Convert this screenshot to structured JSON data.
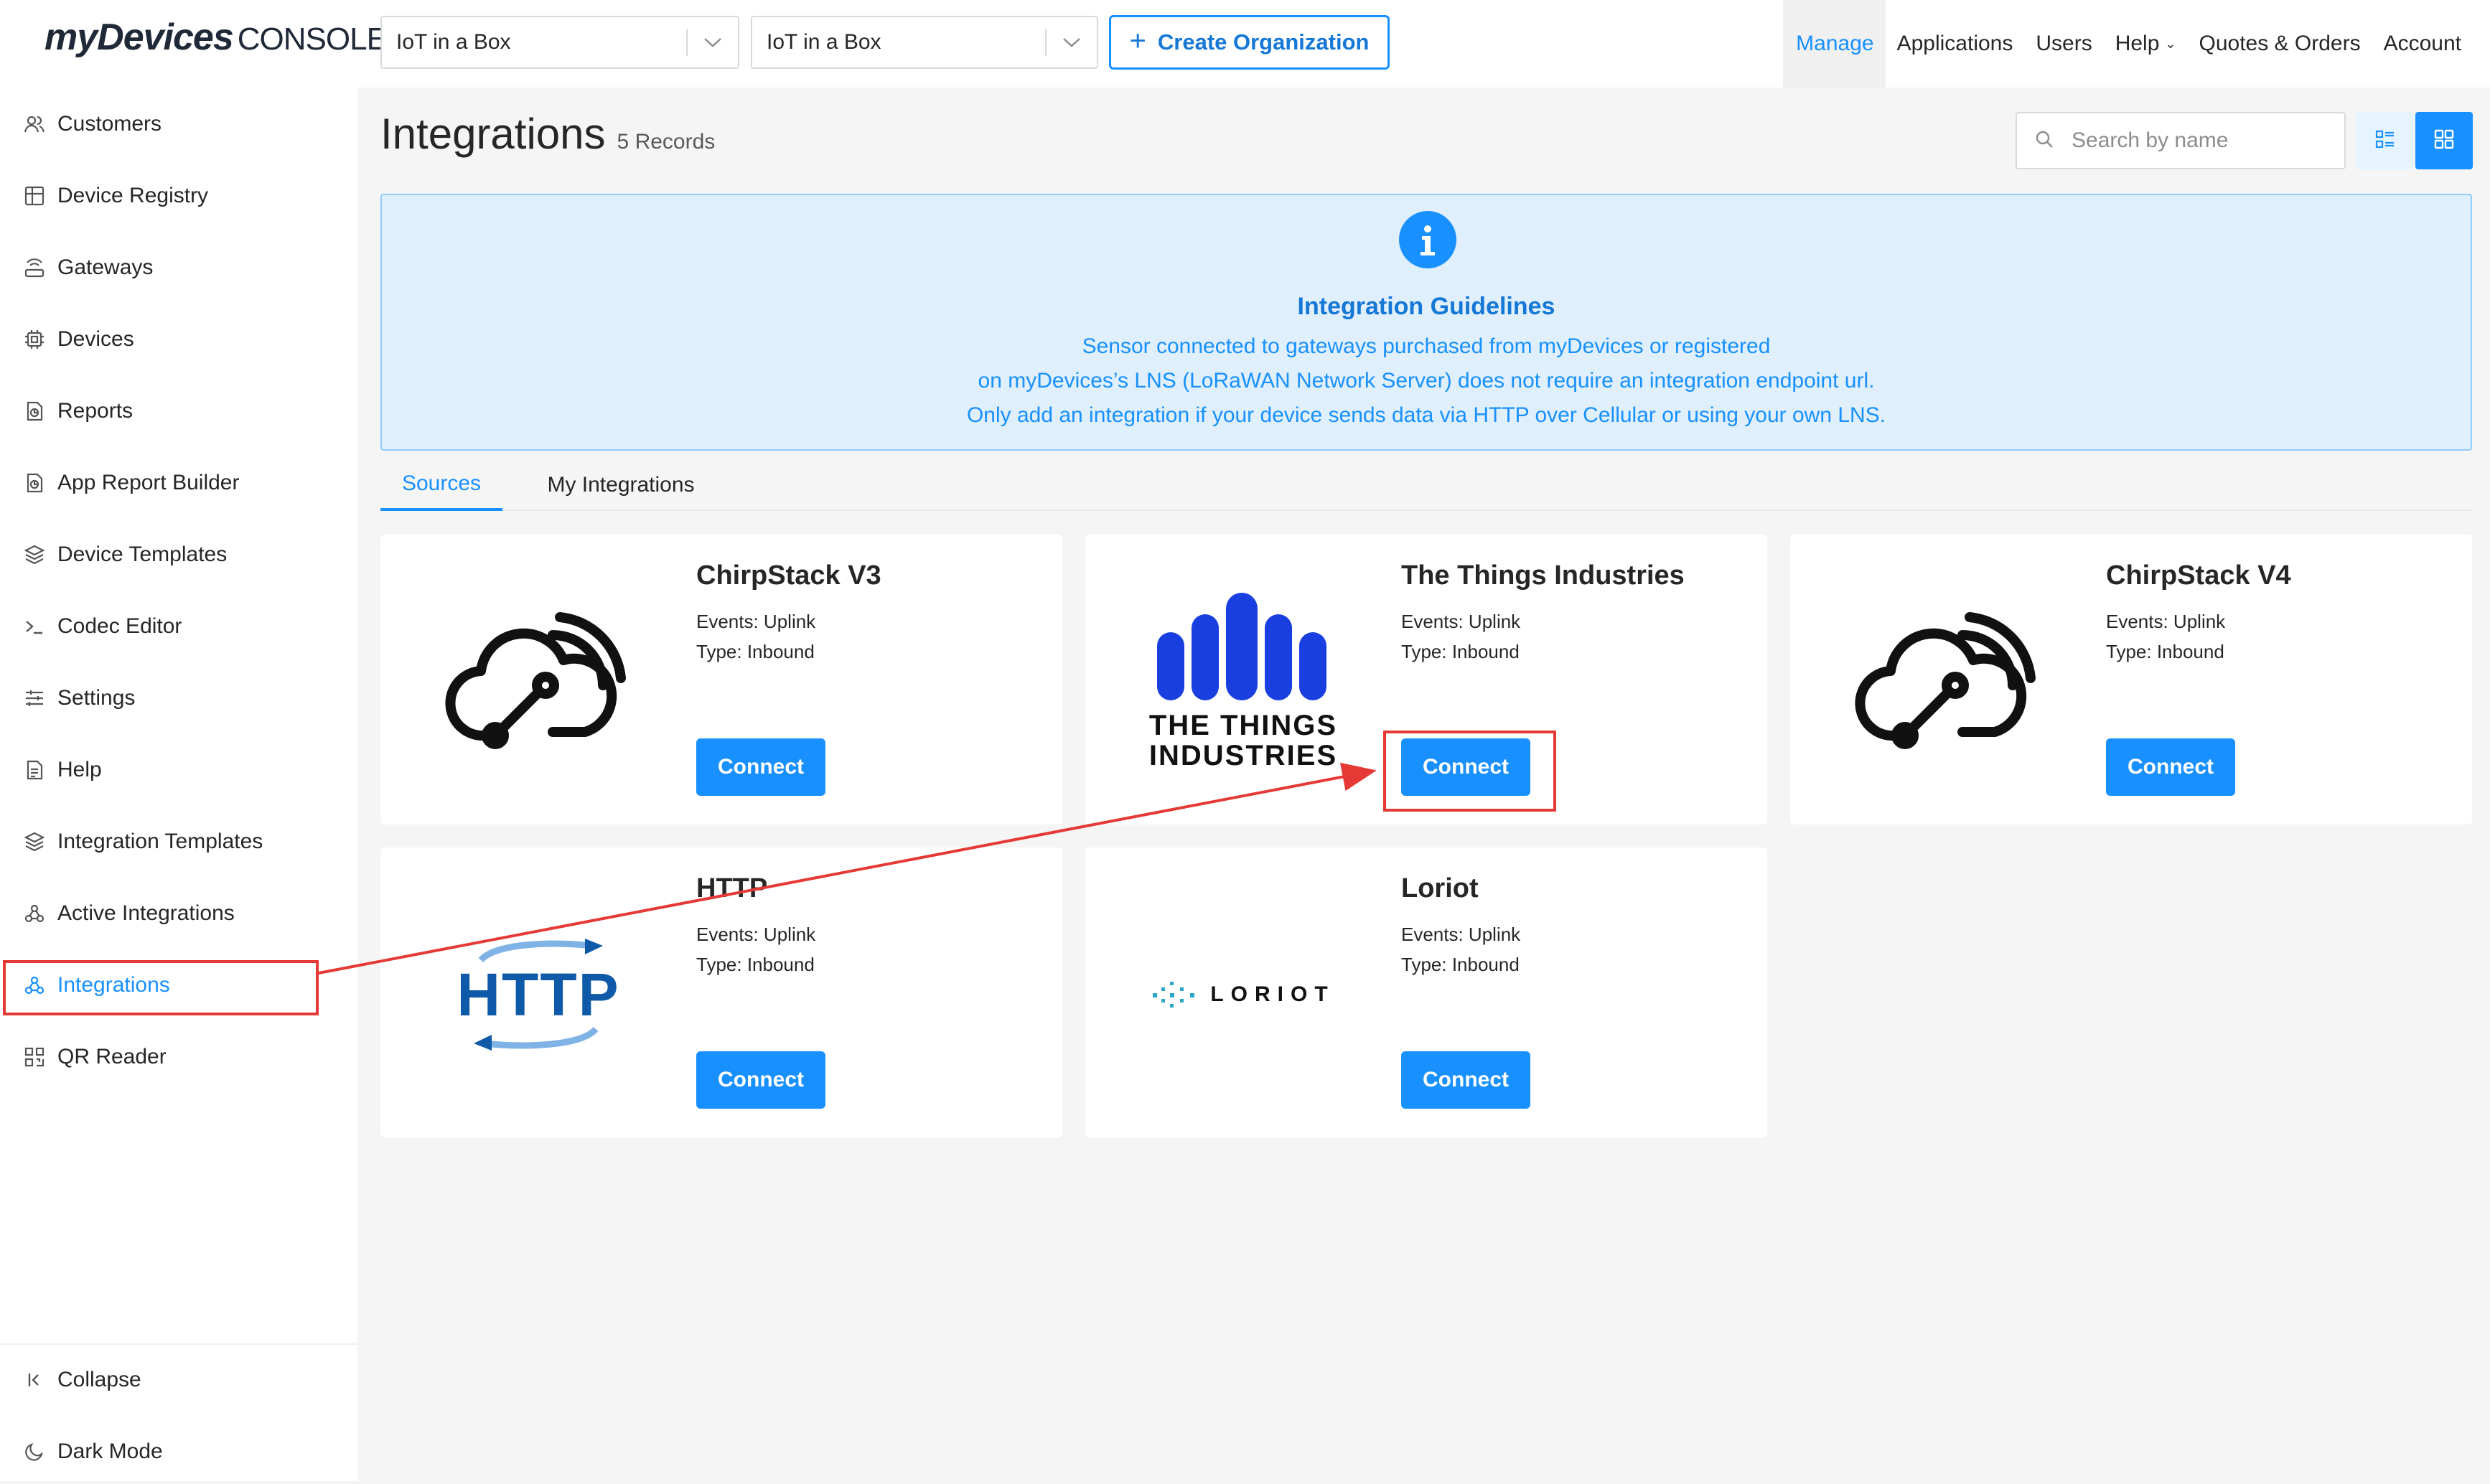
{
  "header": {
    "logo_main": "myDevices",
    "logo_sub": "CONSOLE",
    "org_select_1": "IoT in a Box",
    "org_select_2": "IoT in a Box",
    "create_org_label": "Create Organization",
    "nav": [
      {
        "label": "Manage",
        "active": true
      },
      {
        "label": "Applications"
      },
      {
        "label": "Users"
      },
      {
        "label": "Help"
      },
      {
        "label": "Quotes & Orders"
      },
      {
        "label": "Account"
      }
    ]
  },
  "sidebar": {
    "items": [
      {
        "label": "Customers",
        "icon": "users-icon"
      },
      {
        "label": "Device Registry",
        "icon": "registry-icon"
      },
      {
        "label": "Gateways",
        "icon": "gateway-icon"
      },
      {
        "label": "Devices",
        "icon": "chip-icon"
      },
      {
        "label": "Reports",
        "icon": "report-icon"
      },
      {
        "label": "App Report Builder",
        "icon": "report-builder-icon"
      },
      {
        "label": "Device Templates",
        "icon": "layers-icon"
      },
      {
        "label": "Codec Editor",
        "icon": "terminal-icon"
      },
      {
        "label": "Settings",
        "icon": "sliders-icon"
      },
      {
        "label": "Help",
        "icon": "document-icon"
      },
      {
        "label": "Integration Templates",
        "icon": "layers-icon"
      },
      {
        "label": "Active Integrations",
        "icon": "webhook-icon"
      },
      {
        "label": "Integrations",
        "icon": "webhook-icon",
        "active": true
      },
      {
        "label": "QR Reader",
        "icon": "qr-icon"
      }
    ],
    "collapse_label": "Collapse",
    "dark_mode_label": "Dark Mode"
  },
  "main": {
    "title": "Integrations",
    "records": "5 Records",
    "search_placeholder": "Search by name",
    "banner": {
      "title": "Integration Guidelines",
      "line1": "Sensor connected to gateways purchased from myDevices or registered",
      "line2": "on myDevices’s LNS (LoRaWAN Network Server) does not require an integration endpoint url.",
      "line3": "Only add an integration if your device sends data via HTTP over Cellular or using your own LNS."
    },
    "tabs": [
      {
        "label": "Sources",
        "active": true
      },
      {
        "label": "My Integrations"
      }
    ],
    "cards": [
      {
        "title": "ChirpStack V3",
        "events": "Events: Uplink",
        "type": "Type: Inbound",
        "button": "Connect"
      },
      {
        "title": "The Things Industries",
        "events": "Events: Uplink",
        "type": "Type: Inbound",
        "button": "Connect",
        "logo_text_1": "THE THINGS",
        "logo_text_2": "INDUSTRIES"
      },
      {
        "title": "ChirpStack V4",
        "events": "Events: Uplink",
        "type": "Type: Inbound",
        "button": "Connect"
      },
      {
        "title": "HTTP",
        "events": "Events: Uplink",
        "type": "Type: Inbound",
        "button": "Connect",
        "logo_text": "HTTP"
      },
      {
        "title": "Loriot",
        "events": "Events: Uplink",
        "type": "Type: Inbound",
        "button": "Connect",
        "logo_text": "LORIOT"
      }
    ]
  },
  "colors": {
    "accent": "#1890ff",
    "banner_bg": "#dfeffc",
    "annotation": "#e53935",
    "tti_blue": "#1a3fe0",
    "http_blue": "#0f5aa8"
  }
}
